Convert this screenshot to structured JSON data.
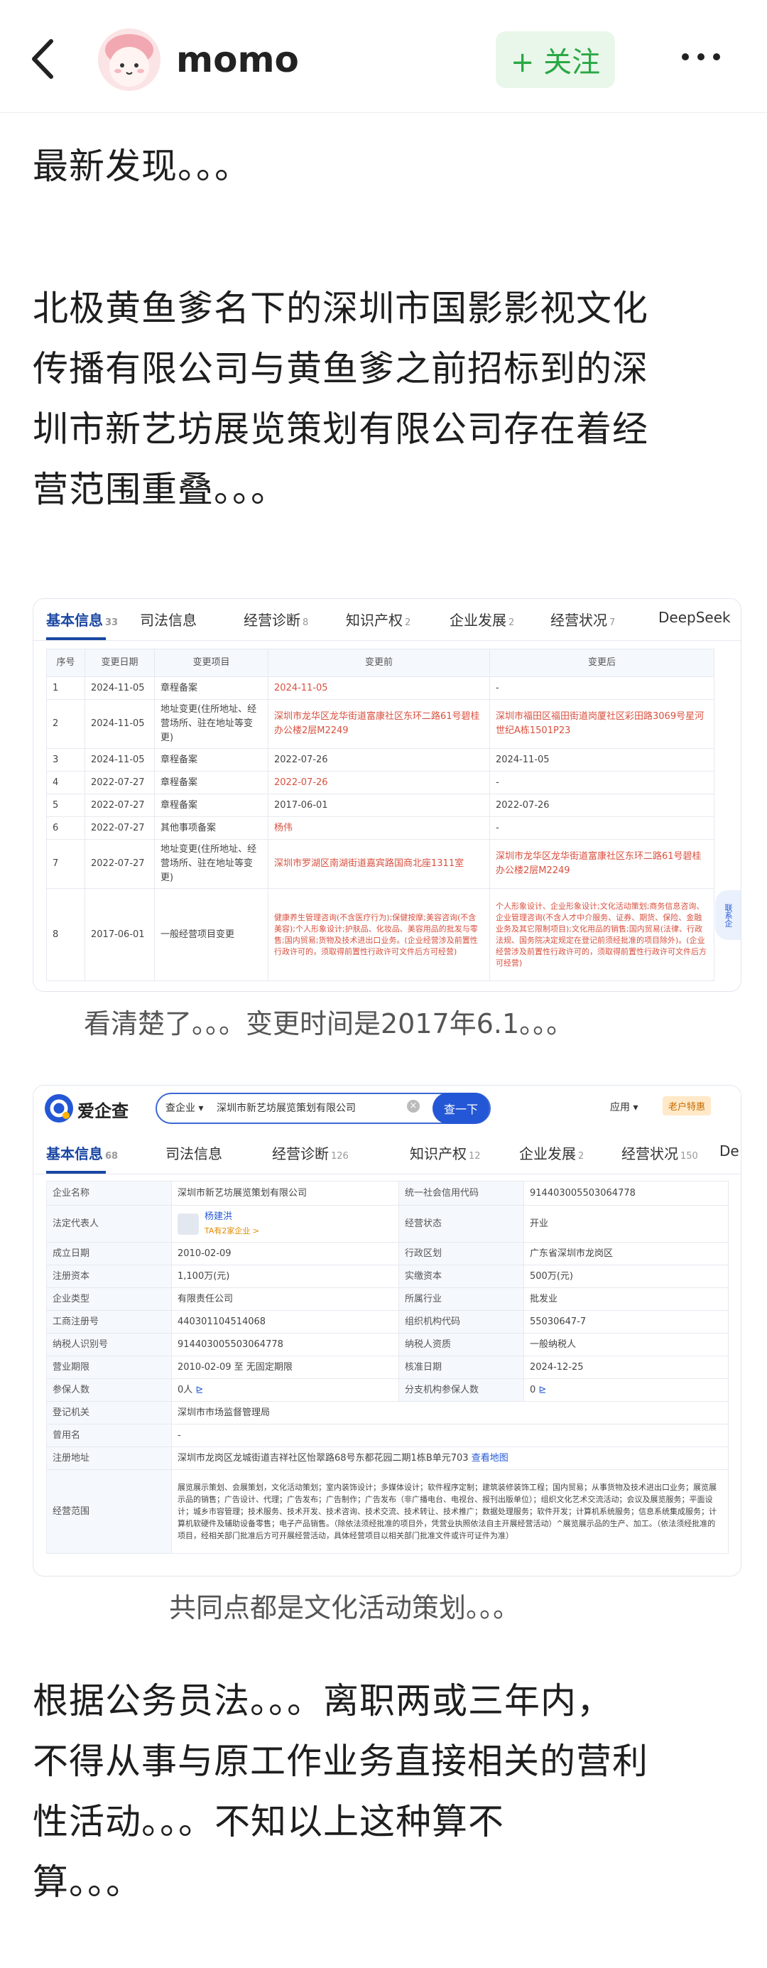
{
  "header": {
    "username": "momo",
    "follow_label": "+ 关注"
  },
  "post": {
    "p1": "最新发现。。。",
    "p2_lines": [
      "北极黄鱼爹名下的深圳市国影影视文化",
      "传播有限公司与黄鱼爹之前招标到的深",
      "圳市新艺坊展览策划有限公司存在着经",
      "营范围重叠。。。"
    ],
    "caption1": "看清楚了。。。变更时间是2017年6.1。。。",
    "caption2": "共同点都是文化活动策划。。。",
    "p3_lines": [
      "根据公务员法。。。离职两或三年内，",
      "不得从事与原工作业务直接相关的营利",
      "性活动。。。不知以上这种算不",
      "算。。。"
    ]
  },
  "screenshot1": {
    "tabs": [
      {
        "label": "基本信息",
        "count": "33"
      },
      {
        "label": "司法信息",
        "count": ""
      },
      {
        "label": "经营诊断",
        "count": "8"
      },
      {
        "label": "知识产权",
        "count": "2"
      },
      {
        "label": "企业发展",
        "count": "2"
      },
      {
        "label": "经营状况",
        "count": "7"
      },
      {
        "label": "DeepSeek",
        "count": ""
      }
    ],
    "headers": [
      "序号",
      "变更日期",
      "变更项目",
      "变更前",
      "变更后"
    ],
    "rows": [
      {
        "no": "1",
        "date": "2024-11-05",
        "item": "章程备案",
        "before": "2024-11-05",
        "after": "-"
      },
      {
        "no": "2",
        "date": "2024-11-05",
        "item": "地址变更(住所地址、经营场所、驻在地址等变更)",
        "before": "深圳市龙华区龙华街道富康社区东环二路61号碧桂办公楼2层M2249",
        "after": "深圳市福田区福田街道岗厦社区彩田路3069号星河世纪A栋1501P23"
      },
      {
        "no": "3",
        "date": "2024-11-05",
        "item": "章程备案",
        "before": "2022-07-26",
        "after": "2024-11-05"
      },
      {
        "no": "4",
        "date": "2022-07-27",
        "item": "章程备案",
        "before": "2022-07-26",
        "after": "-"
      },
      {
        "no": "5",
        "date": "2022-07-27",
        "item": "章程备案",
        "before": "2017-06-01",
        "after": "2022-07-26"
      },
      {
        "no": "6",
        "date": "2022-07-27",
        "item": "其他事项备案",
        "before": "杨伟",
        "after": "-"
      },
      {
        "no": "7",
        "date": "2022-07-27",
        "item": "地址变更(住所地址、经营场所、驻在地址等变更)",
        "before": "深圳市罗湖区南湖街道嘉宾路国商北座1311室",
        "after": "深圳市龙华区龙华街道富康社区东环二路61号碧桂办公楼2层M2249"
      },
      {
        "no": "8",
        "date": "2017-06-01",
        "item": "一般经营项目变更",
        "before": "健康养生管理咨询(不含医疗行为);保健按摩;美容咨询(不含美容);个人形象设计;护肤品、化妆品、美容用品的批发与零售;国内贸易;货物及技术进出口业务。(企业经营涉及前置性行政许可的，须取得前置性行政许可文件后方可经营)",
        "after": "个人形象设计、企业形象设计;文化活动策划;商务信息咨询、企业管理咨询(不含人才中介服务、证券、期货、保险、金融业务及其它限制项目);文化用品的销售;国内贸易(法律、行政法规、国务院决定规定在登记前须经批准的项目除外)。(企业经营涉及前置性行政许可的，须取得前置性行政许可文件后方可经营)"
      }
    ],
    "side_tag": "联系企"
  },
  "screenshot2": {
    "logo": "爱企查",
    "search_scope": "查企业 ▾",
    "search_value": "深圳市新艺坊展览策划有限公司",
    "search_btn": "查一下",
    "nav_right": [
      "应用 ▾",
      "老户特惠"
    ],
    "tabs": [
      {
        "label": "基本信息",
        "count": "68"
      },
      {
        "label": "司法信息",
        "count": ""
      },
      {
        "label": "经营诊断",
        "count": "126"
      },
      {
        "label": "知识产权",
        "count": "12"
      },
      {
        "label": "企业发展",
        "count": "2"
      },
      {
        "label": "经营状况",
        "count": "150"
      },
      {
        "label": "De",
        "count": ""
      }
    ],
    "rows": [
      [
        "企业名称",
        "深圳市新艺坊展览策划有限公司",
        "统一社会信用代码",
        "914403005503064778"
      ],
      [
        "法定代表人",
        "杨建洪",
        "经营状态",
        "开业"
      ],
      [
        "成立日期",
        "2010-02-09",
        "行政区划",
        "广东省深圳市龙岗区"
      ],
      [
        "注册资本",
        "1,100万(元)",
        "实缴资本",
        "500万(元)"
      ],
      [
        "企业类型",
        "有限责任公司",
        "所属行业",
        "批发业"
      ],
      [
        "工商注册号",
        "440301104514068",
        "组织机构代码",
        "55030647-7"
      ],
      [
        "纳税人识别号",
        "914403005503064778",
        "纳税人资质",
        "一般纳税人"
      ],
      [
        "营业期限",
        "2010-02-09 至 无固定期限",
        "核准日期",
        "2024-12-25"
      ],
      [
        "参保人数",
        "0人",
        "分支机构参保人数",
        "0"
      ]
    ],
    "legal_rep_sub": "TA有2家企业 >",
    "reg_authority_label": "登记机关",
    "reg_authority": "深圳市市场监督管理局",
    "former_name_label": "曾用名",
    "former_name": "-",
    "address_label": "注册地址",
    "address": "深圳市龙岗区龙城街道吉祥社区怡翠路68号东都花园二期1栋B单元703",
    "address_link": "查看地图",
    "scope_label": "经营范围",
    "scope": "展览展示策划、会展策划，文化活动策划；室内装饰设计；多媒体设计；软件程序定制；建筑装修装饰工程；国内贸易；从事货物及技术进出口业务；展览展示品的销售；广告设计、代理；广告发布；广告制作；广告发布（非广播电台、电视台、报刊出版单位）；组织文化艺术交流活动；会议及展览服务；平面设计；城乡市容管理；技术服务、技术开发、技术咨询、技术交流、技术转让、技术推广；数据处理服务；软件开发；计算机系统服务；信息系统集成服务；计算机软硬件及辅助设备零售；电子产品销售。（除依法须经批准的项目外，凭营业执照依法自主开展经营活动）^展览展示品的生产、加工。（依法须经批准的项目，经相关部门批准后方可开展经营活动，具体经营项目以相关部门批准文件或许可证件为准）"
  },
  "colors": {
    "accent": "#2aa845",
    "brand": "#1a47a3",
    "highlight": "#d9503f"
  }
}
